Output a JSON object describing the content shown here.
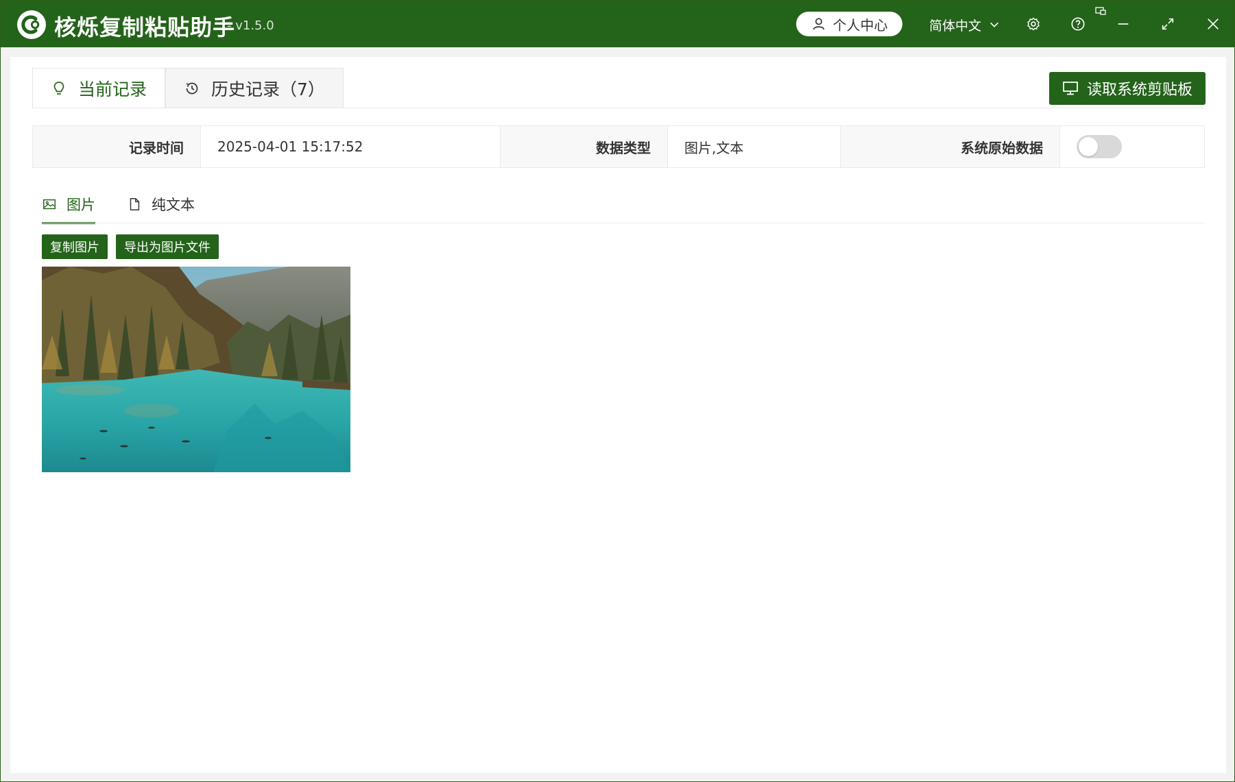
{
  "app": {
    "title": "核烁复制粘贴助手",
    "version": "- v1.5.0"
  },
  "titlebar": {
    "profile_label": "个人中心",
    "language": "简体中文"
  },
  "tabs": [
    {
      "label": "当前记录",
      "active": true
    },
    {
      "label": "历史记录（7）",
      "active": false
    }
  ],
  "read_button_label": "读取系统剪贴板",
  "info": {
    "record_time_label": "记录时间",
    "record_time_value": "2025-04-01 15:17:52",
    "data_type_label": "数据类型",
    "data_type_value": "图片,文本",
    "raw_data_label": "系统原始数据",
    "raw_data_enabled": false
  },
  "subtabs": [
    {
      "label": "图片",
      "active": true
    },
    {
      "label": "纯文本",
      "active": false
    }
  ],
  "image_actions": {
    "copy_label": "复制图片",
    "export_label": "导出为图片文件"
  },
  "colors": {
    "brand": "#24631a",
    "accent_text": "#24631a"
  }
}
